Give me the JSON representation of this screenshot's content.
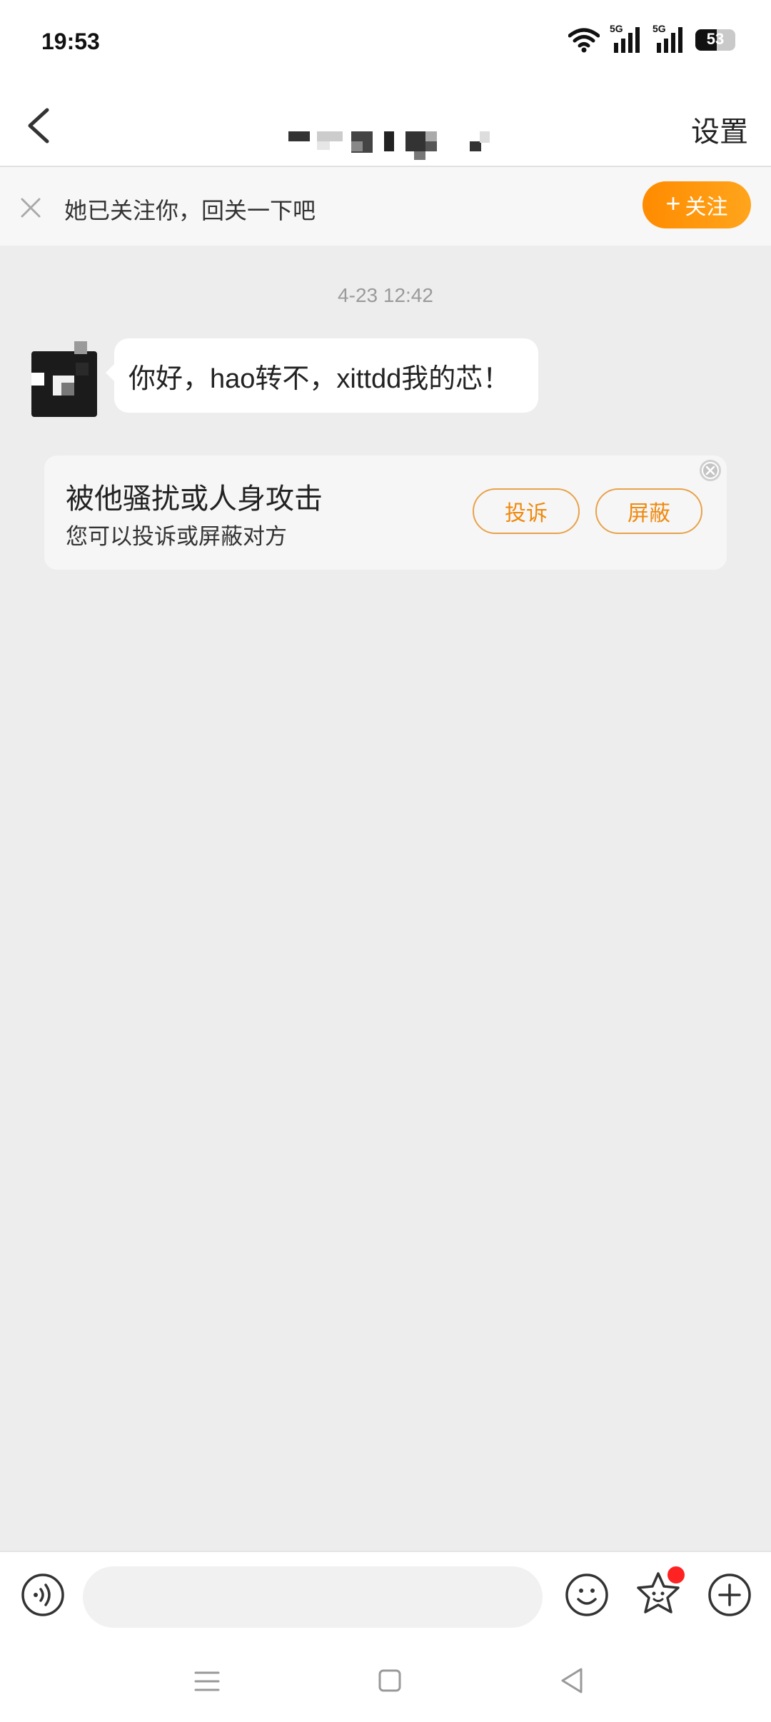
{
  "status_bar": {
    "time": "19:53",
    "network_1": "5G",
    "network_2": "5G",
    "battery": "53",
    "battery_level": 0.53
  },
  "header": {
    "back_icon": "chevron-left-icon",
    "title": "",
    "settings_label": "设置"
  },
  "follow_banner": {
    "close_icon": "close-icon",
    "text": "她已关注你，回关一下吧",
    "follow_plus": "+",
    "follow_label": "关注"
  },
  "chat": {
    "timestamp": "4-23 12:42",
    "messages": [
      {
        "text": "你好，hao转不，xittdd我的芯！"
      }
    ]
  },
  "report_card": {
    "title": "被他骚扰或人身攻击",
    "subtitle": "您可以投诉或屏蔽对方",
    "report_label": "投诉",
    "block_label": "屏蔽",
    "close_icon": "close-circle-icon"
  },
  "input_bar": {
    "voice_icon": "voice-icon",
    "placeholder": "",
    "emoji_icon": "emoji-icon",
    "sticker_icon": "star-sticker-icon",
    "plus_icon": "plus-circle-icon"
  },
  "colors": {
    "accent": "#ff9500",
    "accent_border": "#e8a24a",
    "background": "#ededed"
  }
}
